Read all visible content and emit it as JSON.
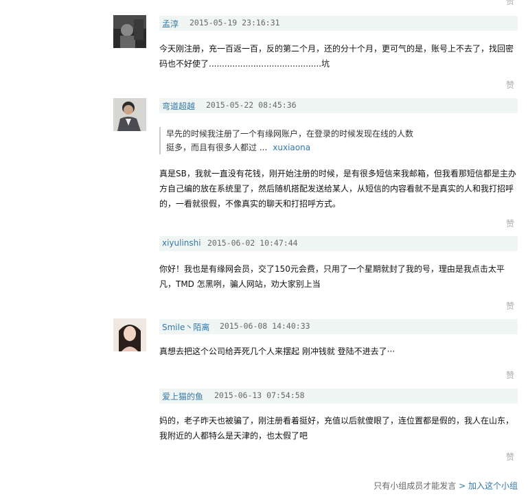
{
  "like_label": "赞",
  "comments": [
    {
      "user": "孟淳",
      "time": "2015-05-19 23:16:31",
      "avatar": "dark-photo",
      "content": "今天刚注册，充一百返一百，反的第二个月，还的分十个月，更可气的是，账号上不去了，找回密码也不好使了...........................................坑"
    },
    {
      "user": "弯道超越",
      "time": "2015-05-22 08:45:36",
      "avatar": "man-photo",
      "quote": {
        "line1": "早先的时候我注册了一个有缘网账户，在登录的时候发现在线的人数",
        "line2": "挺多，而且有很多人都过 ...",
        "author": "xuxiaona"
      },
      "content": "真是SB，我就一直没有花钱，刚开始注册的时候，是有很多短信来我邮箱，但我看那短信都是主办方自己编的放在系统里了，然后随机搭配发送给某人，从短信的内容看就不是真实的人和我打招呼的，一看就很假，不像真实的聊天和打招呼方式。"
    },
    {
      "user": "xiyulinshi",
      "time": "2015-06-02 10:47:44",
      "content": "你好！我也是有缘网会员，交了150元会费，只用了一个星期就封了我的号，理由是我点击太平凡，TMD 怎黑咧，骗人网站，劝大家别上当"
    },
    {
      "user": "Smile丶陌离",
      "time": "2015-06-08 14:40:33",
      "avatar": "woman-photo",
      "content": "真想去把这个公司给弄死几个人来摆起 刚冲钱就 登陆不进去了···"
    },
    {
      "user": "爱上猫的鱼",
      "time": "2015-06-13 07:54:58",
      "content": "妈的，老子昨天也被骗了，刚注册看着挺好，充值以后就傻眼了，连位置都是假的，我人在山东，我附近的人都特么是天津的，也太假了吧"
    }
  ],
  "footer": {
    "note": "只有小组成员才能发言",
    "arrow": ">",
    "join_label": "加入这个小组"
  }
}
